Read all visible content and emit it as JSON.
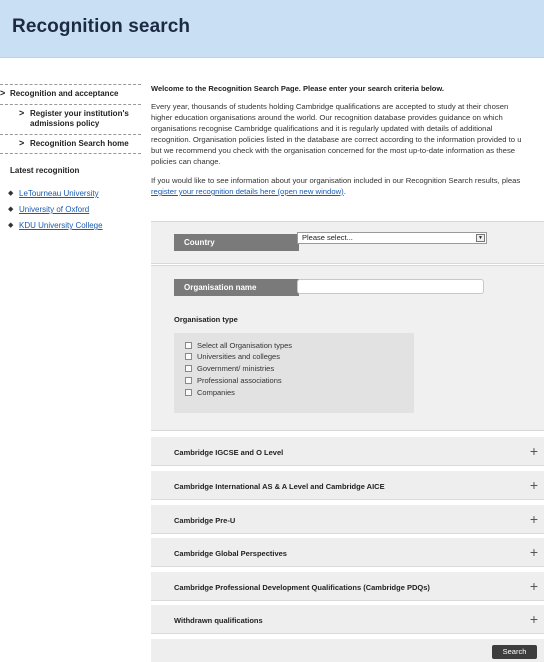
{
  "header": {
    "title": "Recognition search"
  },
  "sidebar": {
    "items": [
      {
        "label": "Recognition and acceptance"
      },
      {
        "label_line1": "Register your institution's",
        "label_line2": "admissions policy"
      },
      {
        "label": "Recognition Search home"
      }
    ],
    "latest_title": "Latest recognition",
    "latest": [
      "LeTourneau University",
      "University of Oxford",
      "KDU University College"
    ]
  },
  "main": {
    "intro_title": "Welcome to the Recognition Search Page. Please enter your search criteria below.",
    "intro_lines": [
      "Every year, thousands of students holding Cambridge qualifications are accepted to study at their chosen",
      "higher education organisations around the world. Our recognition database provides guidance on which",
      "organisations recognise Cambridge qualifications and it is regularly updated with details of additional",
      "recognition. Organisation policies listed in the database are correct according to the information provided to u",
      "but we recommend you check with the organisation concerned for the most up-to-date information as these",
      "policies can change."
    ],
    "intro2_line1": "If you would like to see information about your organisation included in our Recognition Search results, pleas",
    "intro2_link": "register your recognition details here (open new window)",
    "intro2_tail": "."
  },
  "search": {
    "country_label": "Country",
    "country_value": "Please select...",
    "org_name_label": "Organisation name",
    "org_name_value": "",
    "org_type_label": "Organisation type",
    "org_types": [
      "Select all Organisation types",
      "Universities and colleges",
      "Government/ ministries",
      "Professional associations",
      "Companies"
    ],
    "search_button": "Search"
  },
  "accordions": [
    "Cambridge IGCSE and O Level",
    "Cambridge International AS & A Level and Cambridge AICE",
    "Cambridge Pre-U",
    "Cambridge Global Perspectives",
    "Cambridge Professional Development Qualifications (Cambridge PDQs)",
    "Withdrawn qualifications"
  ],
  "icons": {
    "chevron": "chevron-right-icon",
    "bullet": "bullet-icon",
    "expand": "plus-icon"
  }
}
